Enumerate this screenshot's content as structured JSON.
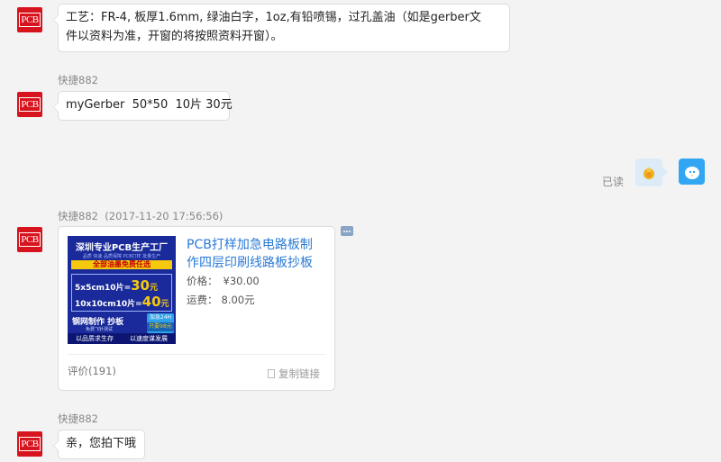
{
  "messages": [
    {
      "text_line1": "工艺：FR-4, 板厚1.6mm, 绿油白字，1oz,有铅喷锡，过孔盖油（如是gerber文",
      "text_line2": "件以资料为准，开窗的将按照资料开窗）。"
    },
    {
      "sender": "快捷882",
      "text": "myGerber  50*50  10片 30元"
    },
    {
      "read_label": "已读"
    },
    {
      "sender": "快捷882",
      "timestamp": "(2017-11-20 17:56:56)"
    },
    {
      "sender": "快捷882",
      "text": "亲，您拍下哦"
    }
  ],
  "avatar_label": "PCB",
  "product_card": {
    "title_line1": "PCB打样加急电路板制",
    "title_line2": "作四层印刷线路板抄板",
    "price_label": "价格：",
    "price": "¥30.00",
    "shipping_label": "运费：",
    "shipping": "8.00元",
    "reviews": "评价(191)",
    "copy_link": "复制链接",
    "image": {
      "headline": "深圳专业PCB生产工厂",
      "subline": "品质 快速 品质保障 PCB打样 批量生产",
      "banner": "全部油墨免费任选",
      "row1_label": "5x5cm10片=",
      "row1_price": "30",
      "row1_unit": "元",
      "row2_label": "10x10cm10片=",
      "row2_price": "40",
      "row2_unit": "元",
      "service": "钢网制作  抄板",
      "test_note": "免费飞针测试",
      "urgent_top": "加急24H",
      "urgent_bottom": "只要98元",
      "footer_left": "以品质求生存",
      "footer_right": "以速度谋发展"
    }
  },
  "colors": {
    "avatar_red": "#d7141e",
    "link_blue": "#2a7ad6",
    "self_avatar": "#32a6f2",
    "emoji_bubble": "#ddebf8"
  }
}
